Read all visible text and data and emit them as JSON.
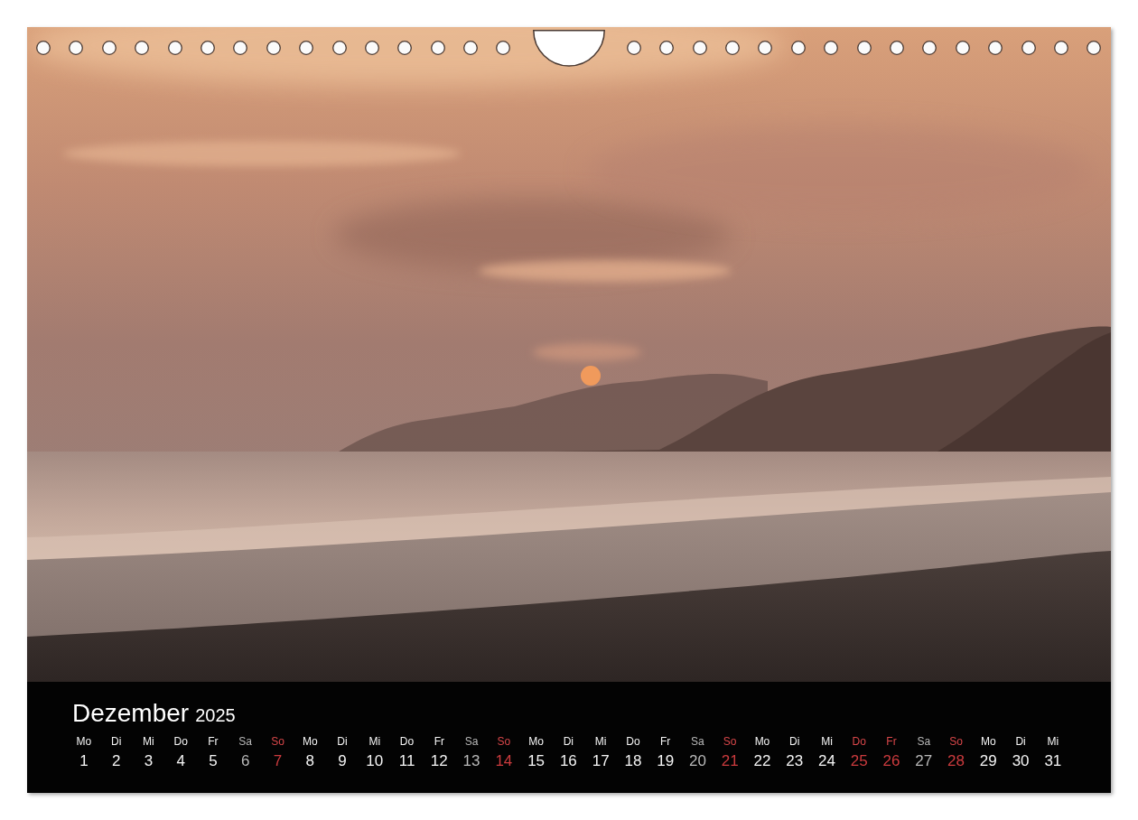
{
  "calendar": {
    "month": "Dezember",
    "year": "2025",
    "days": [
      {
        "weekday": "Mo",
        "date": "1",
        "kind": "weekday"
      },
      {
        "weekday": "Di",
        "date": "2",
        "kind": "weekday"
      },
      {
        "weekday": "Mi",
        "date": "3",
        "kind": "weekday"
      },
      {
        "weekday": "Do",
        "date": "4",
        "kind": "weekday"
      },
      {
        "weekday": "Fr",
        "date": "5",
        "kind": "weekday"
      },
      {
        "weekday": "Sa",
        "date": "6",
        "kind": "saturday"
      },
      {
        "weekday": "So",
        "date": "7",
        "kind": "sunday"
      },
      {
        "weekday": "Mo",
        "date": "8",
        "kind": "weekday"
      },
      {
        "weekday": "Di",
        "date": "9",
        "kind": "weekday"
      },
      {
        "weekday": "Mi",
        "date": "10",
        "kind": "weekday"
      },
      {
        "weekday": "Do",
        "date": "11",
        "kind": "weekday"
      },
      {
        "weekday": "Fr",
        "date": "12",
        "kind": "weekday"
      },
      {
        "weekday": "Sa",
        "date": "13",
        "kind": "saturday"
      },
      {
        "weekday": "So",
        "date": "14",
        "kind": "sunday"
      },
      {
        "weekday": "Mo",
        "date": "15",
        "kind": "weekday"
      },
      {
        "weekday": "Di",
        "date": "16",
        "kind": "weekday"
      },
      {
        "weekday": "Mi",
        "date": "17",
        "kind": "weekday"
      },
      {
        "weekday": "Do",
        "date": "18",
        "kind": "weekday"
      },
      {
        "weekday": "Fr",
        "date": "19",
        "kind": "weekday"
      },
      {
        "weekday": "Sa",
        "date": "20",
        "kind": "saturday"
      },
      {
        "weekday": "So",
        "date": "21",
        "kind": "sunday"
      },
      {
        "weekday": "Mo",
        "date": "22",
        "kind": "weekday"
      },
      {
        "weekday": "Di",
        "date": "23",
        "kind": "weekday"
      },
      {
        "weekday": "Mi",
        "date": "24",
        "kind": "weekday"
      },
      {
        "weekday": "Do",
        "date": "25",
        "kind": "holiday"
      },
      {
        "weekday": "Fr",
        "date": "26",
        "kind": "holiday"
      },
      {
        "weekday": "Sa",
        "date": "27",
        "kind": "saturday"
      },
      {
        "weekday": "So",
        "date": "28",
        "kind": "sunday"
      },
      {
        "weekday": "Mo",
        "date": "29",
        "kind": "weekday"
      },
      {
        "weekday": "Di",
        "date": "30",
        "kind": "weekday"
      },
      {
        "weekday": "Mi",
        "date": "31",
        "kind": "weekday"
      }
    ]
  }
}
